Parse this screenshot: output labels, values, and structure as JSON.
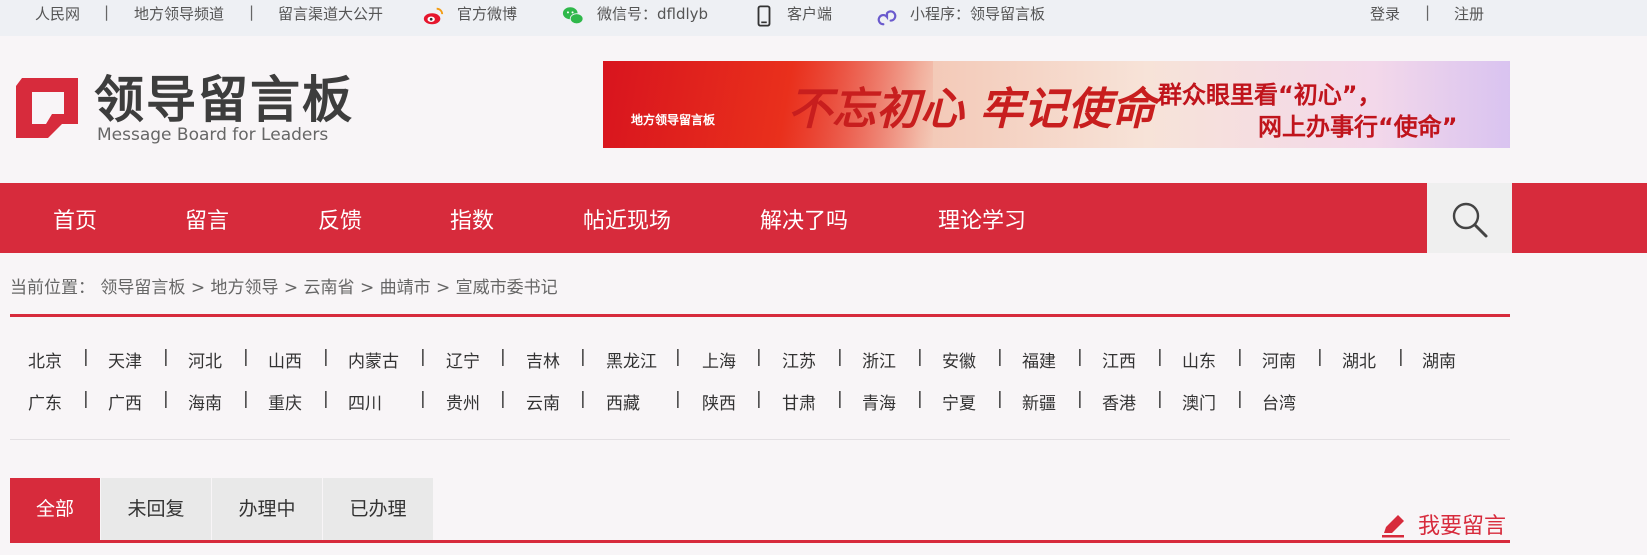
{
  "topbar": {
    "renmin": "人民网",
    "local_channel": "地方领导频道",
    "channels": "留言渠道大公开",
    "weibo": "官方微博",
    "wechat": "微信号：dfldlyb",
    "client": "客户端",
    "miniprogram": "小程序：领导留言板",
    "login": "登录",
    "register": "注册",
    "sep": "|"
  },
  "header": {
    "logo_cn": "领导留言板",
    "logo_en": "Message Board for Leaders",
    "banner": {
      "small_logo": "地方领导留言板",
      "calligraphy": "不忘初心 牢记使命",
      "line1": "群众眼里看“初心”，",
      "line2": "网上办事行“使命”"
    }
  },
  "nav": {
    "items": [
      "首页",
      "留言",
      "反馈",
      "指数",
      "帖近现场",
      "解决了吗",
      "理论学习"
    ]
  },
  "breadcrumb": {
    "prefix": "当前位置：",
    "items": [
      "领导留言板",
      "地方领导",
      "云南省",
      "曲靖市",
      "宣威市委书记"
    ],
    "sep": ">"
  },
  "provinces": {
    "row1": [
      "北京",
      "天津",
      "河北",
      "山西",
      "内蒙古",
      "辽宁",
      "吉林",
      "黑龙江",
      "上海",
      "江苏",
      "浙江",
      "安徽",
      "福建",
      "江西",
      "山东",
      "河南",
      "湖北",
      "湖南"
    ],
    "row2": [
      "广东",
      "广西",
      "海南",
      "重庆",
      "四川",
      "贵州",
      "云南",
      "西藏",
      "陕西",
      "甘肃",
      "青海",
      "宁夏",
      "新疆",
      "香港",
      "澳门",
      "台湾"
    ],
    "sep": "|"
  },
  "tabs": {
    "items": [
      "全部",
      "未回复",
      "办理中",
      "已办理"
    ],
    "active": "全部"
  },
  "write_button": "我要留言",
  "colors": {
    "brand_red": "#d72b3c",
    "topbar_bg": "#eef0f4",
    "page_bg": "#f8f5f7"
  }
}
